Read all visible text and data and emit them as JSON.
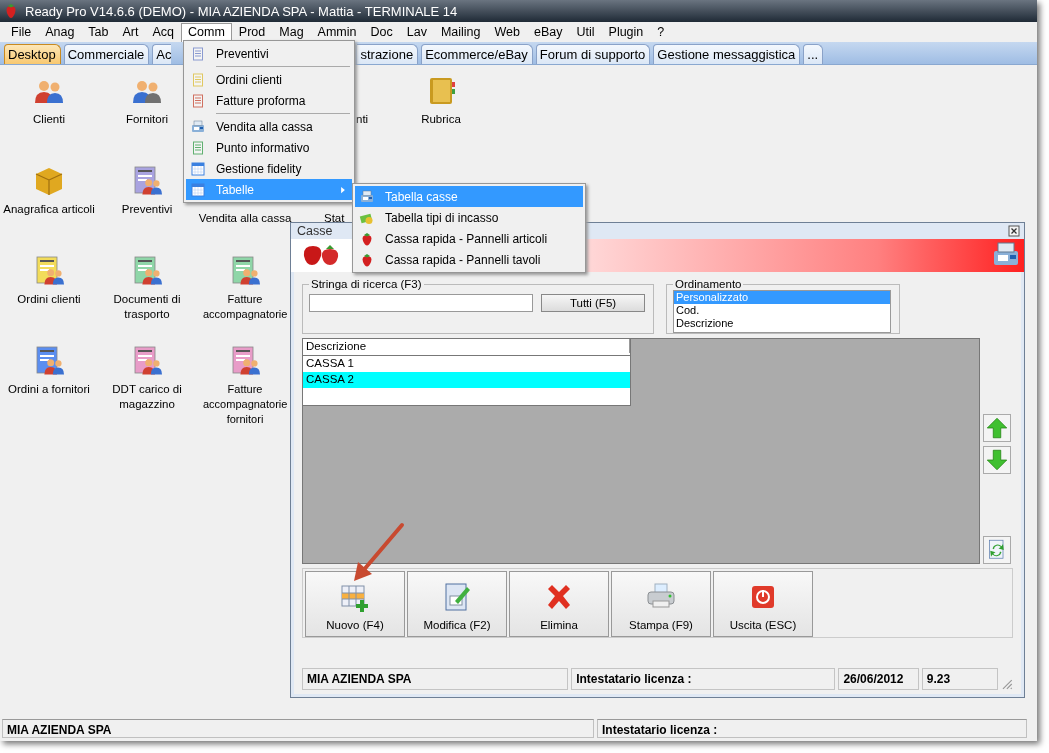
{
  "window": {
    "title": "Ready Pro V14.6.6 (DEMO)  - MIA AZIENDA SPA - Mattia - TERMINALE 14"
  },
  "menu_bar": [
    {
      "label": "File",
      "selected": false
    },
    {
      "label": "Anag",
      "selected": false
    },
    {
      "label": "Tab",
      "selected": false
    },
    {
      "label": "Art",
      "selected": false
    },
    {
      "label": "Acq",
      "selected": false
    },
    {
      "label": "Comm",
      "selected": true
    },
    {
      "label": "Prod",
      "selected": false
    },
    {
      "label": "Mag",
      "selected": false
    },
    {
      "label": "Ammin",
      "selected": false
    },
    {
      "label": "Doc",
      "selected": false
    },
    {
      "label": "Lav",
      "selected": false
    },
    {
      "label": "Mailing",
      "selected": false
    },
    {
      "label": "Web",
      "selected": false
    },
    {
      "label": "eBay",
      "selected": false
    },
    {
      "label": "Util",
      "selected": false
    },
    {
      "label": "Plugin",
      "selected": false
    },
    {
      "label": "?",
      "selected": false
    }
  ],
  "tabs": [
    {
      "label": "Desktop",
      "selected": true
    },
    {
      "label": "Commerciale",
      "selected": false
    },
    {
      "label": "Ac",
      "selected": false
    },
    {
      "label": "strazione",
      "selected": false
    },
    {
      "label": "Ecommerce/eBay",
      "selected": false
    },
    {
      "label": "Forum di supporto",
      "selected": false
    },
    {
      "label": "Gestione messaggistica",
      "selected": false
    },
    {
      "label": "...",
      "selected": false
    }
  ],
  "desktop": {
    "rows": [
      [
        {
          "kind": "clients",
          "label": "Clienti"
        },
        {
          "kind": "suppliers",
          "label": "Fornitori"
        },
        {
          "kind": "covered"
        },
        {
          "kind": "partial",
          "label": "nti"
        },
        {
          "kind": "book",
          "label": "Rubrica"
        }
      ],
      [
        {
          "kind": "box",
          "label": "Anagrafica articoli"
        },
        {
          "kind": "doc",
          "color": "#a9a3e0",
          "label": "Preventivi"
        },
        {
          "kind": "label",
          "label": "Vendita alla cassa"
        },
        {
          "kind": "partial",
          "label": "Stat"
        }
      ],
      [
        {
          "kind": "doc",
          "color": "#f2dc5a",
          "label": "Ordini clienti"
        },
        {
          "kind": "doc",
          "color": "#8fd6a8",
          "label": "Documenti di trasporto"
        },
        {
          "kind": "doc",
          "color": "#8fd6a8",
          "label": "Fatture accompagnatorie"
        }
      ],
      [
        {
          "kind": "doc",
          "color": "#5b8ef0",
          "label": "Ordini a fornitori"
        },
        {
          "kind": "doc",
          "color": "#e89cc8",
          "label": "DDT carico di magazzino"
        },
        {
          "kind": "doc",
          "color": "#e89cc8",
          "label": "Fatture accompagnatorie fornitori"
        }
      ]
    ]
  },
  "comm_menu": [
    {
      "kind": "item",
      "label": "Preventivi",
      "selected": false
    },
    {
      "kind": "separator"
    },
    {
      "kind": "item",
      "label": "Ordini clienti",
      "selected": false
    },
    {
      "kind": "item",
      "label": "Fatture proforma",
      "selected": false
    },
    {
      "kind": "separator"
    },
    {
      "kind": "item",
      "label": "Vendita alla cassa",
      "selected": false
    },
    {
      "kind": "item",
      "label": "Punto informativo",
      "selected": false
    },
    {
      "kind": "item",
      "label": "Gestione fidelity",
      "selected": false
    },
    {
      "kind": "submenu",
      "label": "Tabelle",
      "selected": true
    }
  ],
  "tabelle_submenu": [
    {
      "label": "Tabella casse",
      "selected": true
    },
    {
      "label": "Tabella tipi di incasso",
      "selected": false
    },
    {
      "label": "Cassa rapida - Pannelli articoli",
      "selected": false
    },
    {
      "label": "Cassa rapida - Pannelli tavoli",
      "selected": false
    }
  ],
  "casse_window": {
    "title": "Casse",
    "search": {
      "label": "Stringa di ricerca (F3)",
      "button": "Tutti (F5)"
    },
    "ordering": {
      "label": "Ordinamento",
      "options": [
        {
          "label": "Personalizzato",
          "selected": true
        },
        {
          "label": "Cod.",
          "selected": false
        },
        {
          "label": "Descrizione",
          "selected": false
        }
      ]
    },
    "table": {
      "columns": [
        "Descrizione"
      ],
      "rows": [
        {
          "cells": [
            "CASSA 1"
          ],
          "selected": false
        },
        {
          "cells": [
            "CASSA 2"
          ],
          "selected": true
        }
      ]
    },
    "toolbar": [
      {
        "label": "Nuovo (F4)"
      },
      {
        "label": "Modifica (F2)"
      },
      {
        "label": "Elimina"
      },
      {
        "label": "Stampa (F9)"
      },
      {
        "label": "Uscita (ESC)"
      }
    ],
    "status_bar": [
      "MIA AZIENDA SPA",
      "Intestatario licenza :",
      "26/06/2012",
      "9.23"
    ]
  },
  "status_bar": [
    "MIA AZIENDA SPA",
    "Intestatario licenza :"
  ]
}
